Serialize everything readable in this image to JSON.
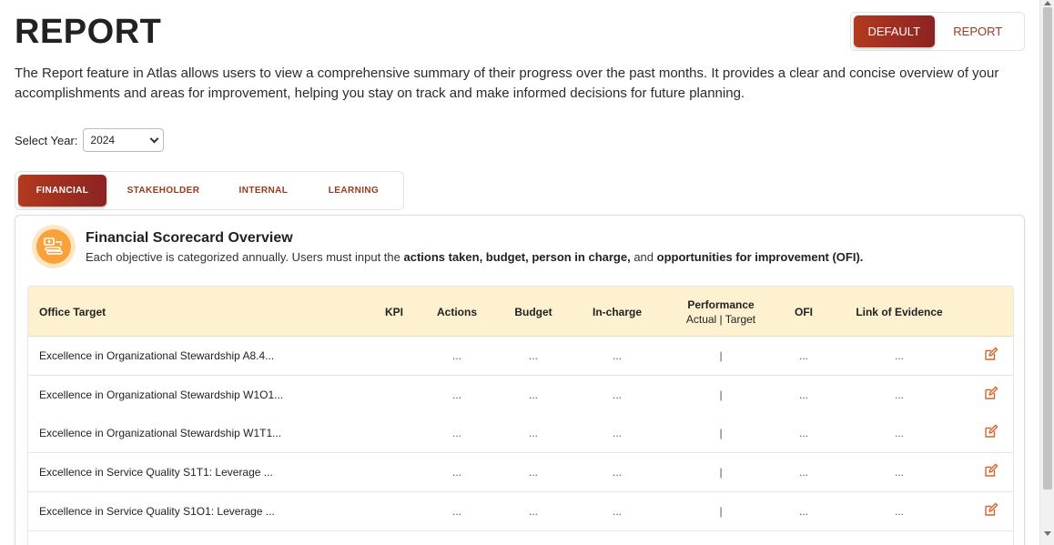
{
  "page": {
    "title": "REPORT",
    "description": "The Report feature in Atlas allows users to view a comprehensive summary of their progress over the past months. It provides a clear and concise overview of your accomplishments and areas for improvement, helping you stay on track and make informed decisions for future planning."
  },
  "view_toggle": {
    "default_label": "DEFAULT",
    "report_label": "REPORT",
    "active": "DEFAULT"
  },
  "year": {
    "label": "Select Year:",
    "selected": "2024"
  },
  "tabs": [
    {
      "label": "FINANCIAL",
      "active": true
    },
    {
      "label": "STAKEHOLDER",
      "active": false
    },
    {
      "label": "INTERNAL",
      "active": false
    },
    {
      "label": "LEARNING",
      "active": false
    }
  ],
  "card": {
    "icon": "money-coins-icon",
    "title": "Financial Scorecard Overview",
    "subtitle_parts": {
      "p1": "Each objective is categorized annually. Users must input the ",
      "b1": "actions taken, budget, person in charge,",
      "p2": " and ",
      "b2": "opportunities for improvement (OFI)."
    }
  },
  "table": {
    "headers": {
      "office_target": "Office Target",
      "kpi": "KPI",
      "actions": "Actions",
      "budget": "Budget",
      "in_charge": "In-charge",
      "performance": "Performance",
      "performance_sub": "Actual | Target",
      "ofi": "OFI",
      "link": "Link of Evidence"
    },
    "rows": [
      {
        "target": "Excellence in Organizational Stewardship A8.4...",
        "actions": "...",
        "budget": "...",
        "in_charge": "...",
        "performance": "|",
        "ofi": "...",
        "link": "..."
      },
      {
        "target": "Excellence in Organizational Stewardship W1O1...",
        "actions": "...",
        "budget": "...",
        "in_charge": "...",
        "performance": "|",
        "ofi": "...",
        "link": "..."
      },
      {
        "target": "Excellence in Organizational Stewardship W1T1...",
        "actions": "...",
        "budget": "...",
        "in_charge": "...",
        "performance": "|",
        "ofi": "...",
        "link": "..."
      },
      {
        "target": "Excellence in Service Quality S1T1: Leverage ...",
        "actions": "...",
        "budget": "...",
        "in_charge": "...",
        "performance": "|",
        "ofi": "...",
        "link": "..."
      },
      {
        "target": "Excellence in Service Quality S1O1: Leverage ...",
        "actions": "...",
        "budget": "...",
        "in_charge": "...",
        "performance": "|",
        "ofi": "...",
        "link": "..."
      }
    ]
  },
  "colors": {
    "accent": "#a8301f",
    "accent_text": "#9a3a1c",
    "header_bg": "#fdf1cf",
    "icon_orange": "#f7a23a",
    "edit_icon": "#d9622b"
  }
}
